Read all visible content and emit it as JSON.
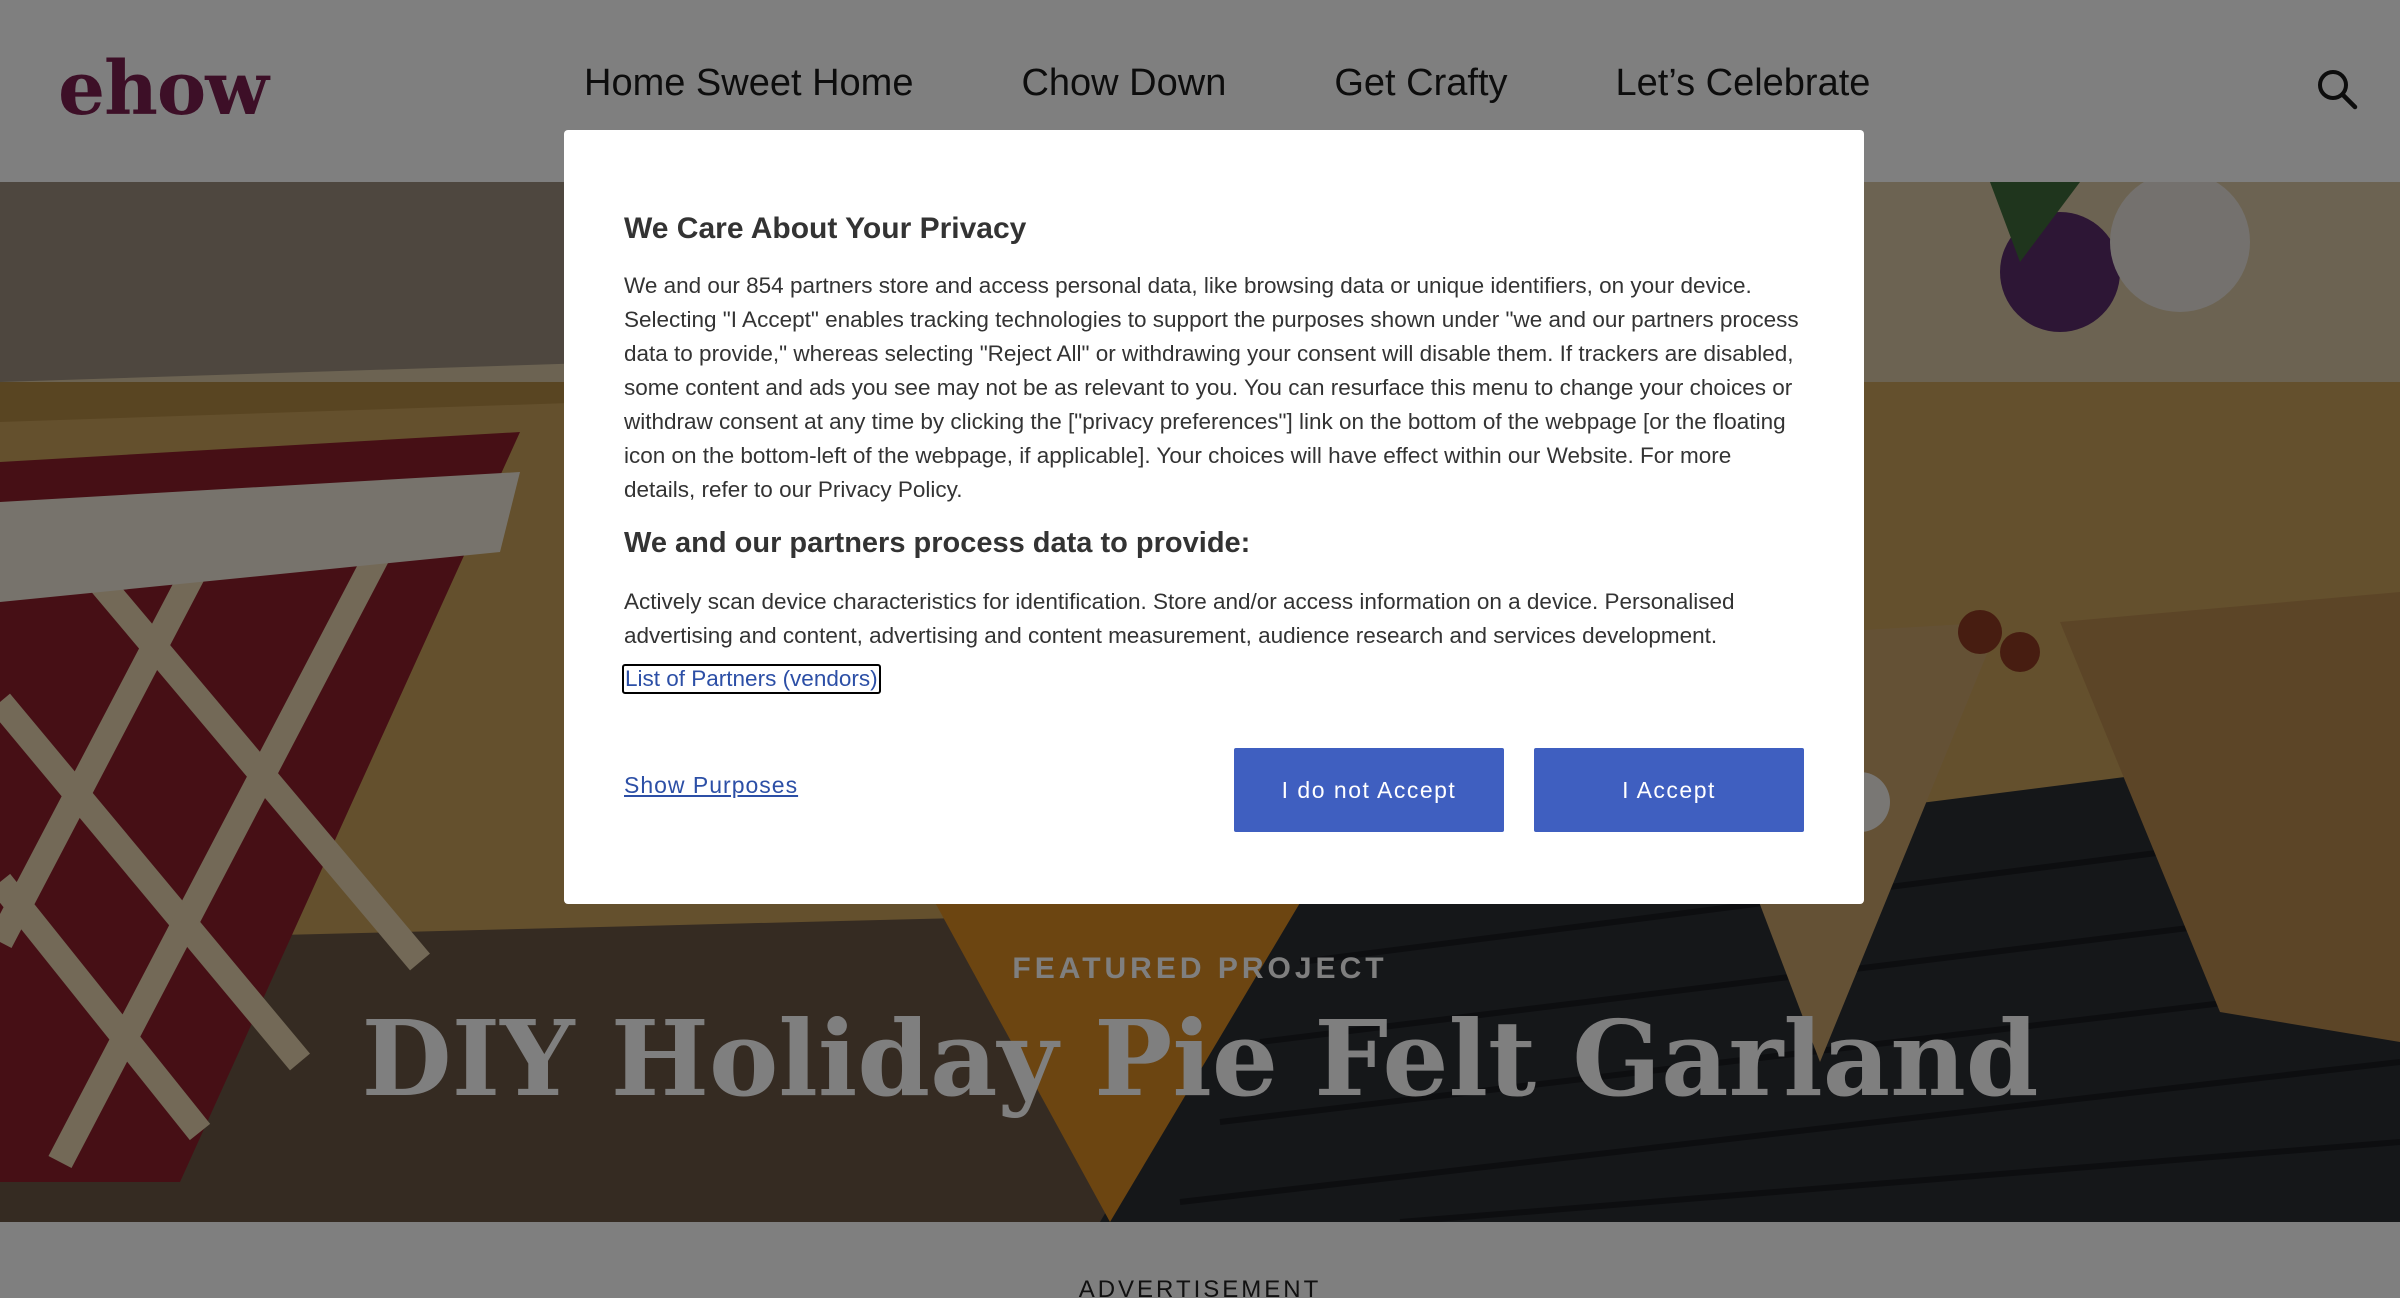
{
  "header": {
    "logo": "ehow",
    "nav": [
      "Home Sweet Home",
      "Chow Down",
      "Get Crafty",
      "Let’s Celebrate"
    ],
    "search_icon": "search-icon"
  },
  "hero": {
    "kicker": "FEATURED PROJECT",
    "title": "DIY Holiday Pie Felt Garland"
  },
  "advertisement_label": "ADVERTISEMENT",
  "consent": {
    "title": "We Care About Your Privacy",
    "body": "We and our 854 partners store and access personal data, like browsing data or unique identifiers, on your device. Selecting \"I Accept\" enables tracking technologies to support the purposes shown under \"we and our partners process data to provide,\" whereas selecting \"Reject All\" or withdrawing your consent will disable them. If trackers are disabled, some content and ads you see may not be as relevant to you. You can resurface this menu to change your choices or withdraw consent at any time by clicking the [\"privacy preferences\"] link on the bottom of the webpage [or the floating icon on the bottom-left of the webpage, if applicable]. Your choices will have effect within our Website. For more details, refer to our Privacy Policy.",
    "subtitle": "We and our partners process data to provide:",
    "purposes": "Actively scan device characteristics for identification. Store and/or access information on a device. Personalised advertising and content, advertising and content measurement, audience research and services development.",
    "partners_link": "List of Partners (vendors)",
    "show_purposes": "Show Purposes",
    "reject_button": "I do not Accept",
    "accept_button": "I Accept"
  },
  "colors": {
    "logo": "#7a1f4e",
    "button": "#3f5fc0",
    "link": "#2c4fa6"
  }
}
